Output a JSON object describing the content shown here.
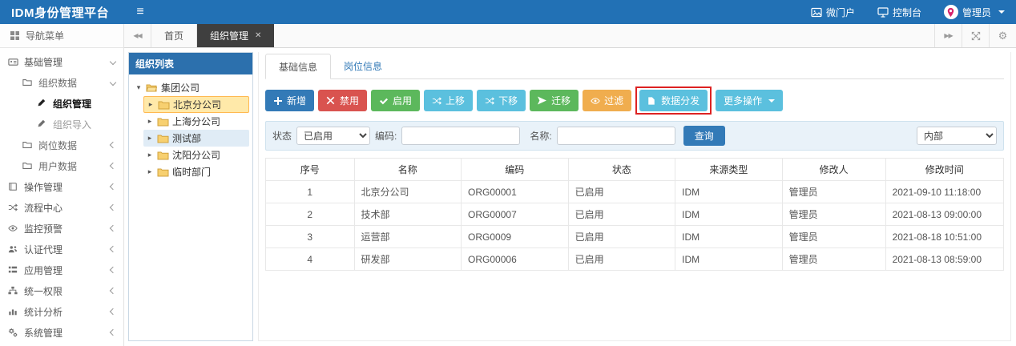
{
  "topbar": {
    "brand": "IDM身份管理平台",
    "portal_label": "微门户",
    "console_label": "控制台",
    "user_label": "管理员"
  },
  "tabstrip": {
    "home_tab": "首页",
    "active_tab": "组织管理"
  },
  "sidebar": {
    "header": "导航菜单",
    "items": [
      {
        "label": "基础管理"
      },
      {
        "label": "组织数据"
      },
      {
        "label": "组织管理"
      },
      {
        "label": "组织导入"
      },
      {
        "label": "岗位数据"
      },
      {
        "label": "用户数据"
      },
      {
        "label": "操作管理"
      },
      {
        "label": "流程中心"
      },
      {
        "label": "监控预警"
      },
      {
        "label": "认证代理"
      },
      {
        "label": "应用管理"
      },
      {
        "label": "统一权限"
      },
      {
        "label": "统计分析"
      },
      {
        "label": "系统管理"
      }
    ]
  },
  "tree": {
    "title": "组织列表",
    "nodes": [
      {
        "label": "集团公司"
      },
      {
        "label": "北京分公司"
      },
      {
        "label": "上海分公司"
      },
      {
        "label": "测试部"
      },
      {
        "label": "沈阳分公司"
      },
      {
        "label": "临时部门"
      }
    ]
  },
  "main": {
    "tabs": [
      {
        "label": "基础信息"
      },
      {
        "label": "岗位信息"
      }
    ],
    "toolbar": [
      {
        "label": "新增"
      },
      {
        "label": "禁用"
      },
      {
        "label": "启用"
      },
      {
        "label": "上移"
      },
      {
        "label": "下移"
      },
      {
        "label": "迁移"
      },
      {
        "label": "过滤"
      },
      {
        "label": "数据分发"
      },
      {
        "label": "更多操作"
      }
    ],
    "filters": {
      "status_label": "状态",
      "status_value": "已启用",
      "code_label": "编码:",
      "name_label": "名称:",
      "search_label": "查询",
      "scope_value": "内部"
    },
    "table": {
      "headers": [
        "序号",
        "名称",
        "编码",
        "状态",
        "来源类型",
        "修改人",
        "修改时间"
      ],
      "rows": [
        [
          "1",
          "北京分公司",
          "ORG00001",
          "已启用",
          "IDM",
          "管理员",
          "2021-09-10 11:18:00"
        ],
        [
          "2",
          "技术部",
          "ORG00007",
          "已启用",
          "IDM",
          "管理员",
          "2021-08-13 09:00:00"
        ],
        [
          "3",
          "运营部",
          "ORG0009",
          "已启用",
          "IDM",
          "管理员",
          "2021-08-18 10:51:00"
        ],
        [
          "4",
          "研发部",
          "ORG00006",
          "已启用",
          "IDM",
          "管理员",
          "2021-08-13 08:59:00"
        ]
      ]
    }
  },
  "colors": {
    "topbar": "#2271b5",
    "primary": "#337ab7",
    "danger": "#d9534f",
    "success": "#5cb85c",
    "info": "#5bc0de",
    "warning": "#f0ad4e",
    "tree_header": "#2c70ad",
    "tree_selected_bg": "#ffe9a9",
    "annotation_border": "#dd2222"
  },
  "annotation": {
    "target_button": "数据分发"
  }
}
